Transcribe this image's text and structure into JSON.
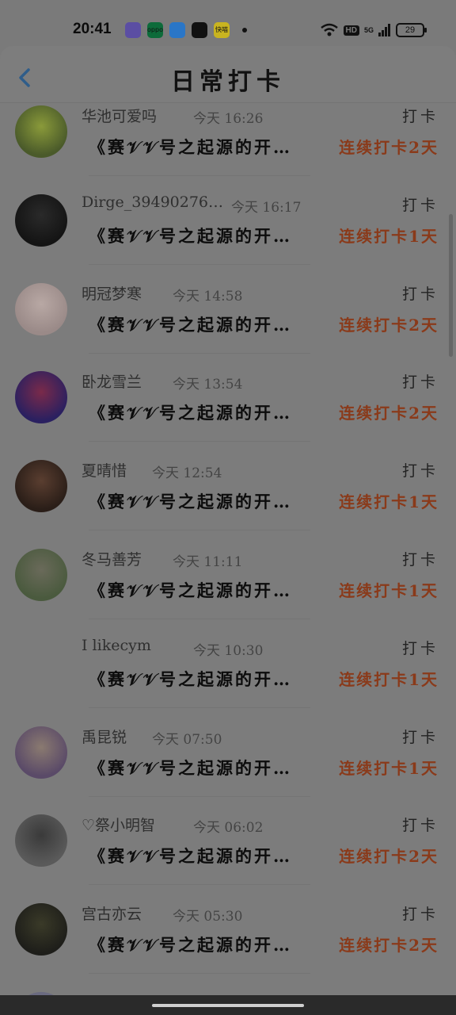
{
  "status_bar": {
    "time": "20:41",
    "apps": [
      {
        "name": "app-icon-purple",
        "color": "#5b4ea3",
        "text": ""
      },
      {
        "name": "app-icon-oppo",
        "color": "#0d6b3a",
        "text": "oppo"
      },
      {
        "name": "app-icon-blue",
        "color": "#2a76c7",
        "text": ""
      },
      {
        "name": "app-icon-black",
        "color": "#111111",
        "text": ""
      },
      {
        "name": "app-icon-yellow",
        "color": "#c9b420",
        "text": "快喵"
      }
    ],
    "hd_label": "HD",
    "network_label": "5G",
    "battery": "29"
  },
  "header": {
    "title": "日常打卡",
    "back_icon": "chevron-left-icon",
    "accent": "#2f5d8a"
  },
  "colors": {
    "streak": "#8a3a1a"
  },
  "entries": [
    {
      "user": "华池可爱吗",
      "time": "今天 16:26",
      "tag": "打卡",
      "title": "《赛𝒱𝒱号之起源的开…",
      "streak": "连续打卡2天",
      "avatar_bg": "#4a5a2a",
      "avatar_fg": "#8a9a3a",
      "has_avatar": true
    },
    {
      "user": "Dirge_39490276…",
      "time": "今天 16:17",
      "tag": "打卡",
      "title": "《赛𝒱𝒱号之起源的开…",
      "streak": "连续打卡1天",
      "avatar_bg": "#141414",
      "avatar_fg": "#2a2a2a",
      "has_avatar": true
    },
    {
      "user": "明冠梦寒",
      "time": "今天 14:58",
      "tag": "打卡",
      "title": "《赛𝒱𝒱号之起源的开…",
      "streak": "连续打卡2天",
      "avatar_bg": "#9a8a88",
      "avatar_fg": "#b8a8a4",
      "has_avatar": true
    },
    {
      "user": "卧龙雪兰",
      "time": "今天 13:54",
      "tag": "打卡",
      "title": "《赛𝒱𝒱号之起源的开…",
      "streak": "连续打卡2天",
      "avatar_bg": "#2a2060",
      "avatar_fg": "#7a2a4a",
      "has_avatar": true
    },
    {
      "user": "夏晴惜",
      "time": "今天 12:54",
      "tag": "打卡",
      "title": "《赛𝒱𝒱号之起源的开…",
      "streak": "连续打卡1天",
      "avatar_bg": "#2a1e18",
      "avatar_fg": "#5a3e30",
      "has_avatar": true
    },
    {
      "user": "冬马善芳",
      "time": "今天 11:11",
      "tag": "打卡",
      "title": "《赛𝒱𝒱号之起源的开…",
      "streak": "连续打卡1天",
      "avatar_bg": "#4a5a3e",
      "avatar_fg": "#6a6a5a",
      "has_avatar": true
    },
    {
      "user": "I likecym",
      "time": "今天 10:30",
      "tag": "打卡",
      "title": "《赛𝒱𝒱号之起源的开…",
      "streak": "连续打卡1天",
      "avatar_bg": "#7c7c7c",
      "avatar_fg": "#7c7c7c",
      "has_avatar": false
    },
    {
      "user": "禹昆锐",
      "time": "今天 07:50",
      "tag": "打卡",
      "title": "《赛𝒱𝒱号之起源的开…",
      "streak": "连续打卡1天",
      "avatar_bg": "#5a4a68",
      "avatar_fg": "#8a7a70",
      "has_avatar": true
    },
    {
      "user": "♡祭小明智",
      "time": "今天 06:02",
      "tag": "打卡",
      "title": "《赛𝒱𝒱号之起源的开…",
      "streak": "连续打卡2天",
      "avatar_bg": "#5a5a5a",
      "avatar_fg": "#3a3a3a",
      "has_avatar": true
    },
    {
      "user": "宫古亦云",
      "time": "今天 05:30",
      "tag": "打卡",
      "title": "《赛𝒱𝒱号之起源的开…",
      "streak": "连续打卡2天",
      "avatar_bg": "#1e1e1a",
      "avatar_fg": "#3a3a28",
      "has_avatar": true
    },
    {
      "user": "",
      "time": "",
      "tag": "",
      "title": "",
      "streak": "",
      "avatar_bg": "#6a6a80",
      "avatar_fg": "#6a6a80",
      "has_avatar": true
    }
  ]
}
